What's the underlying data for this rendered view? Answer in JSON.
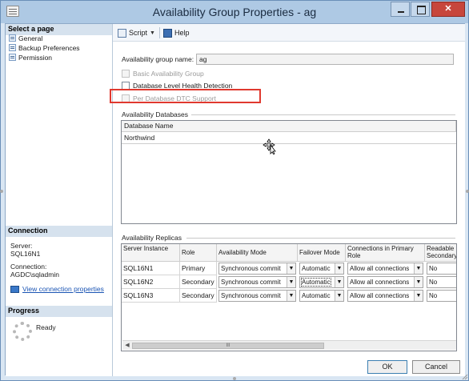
{
  "window": {
    "title": "Availability Group Properties - ag"
  },
  "sidebar": {
    "select_page_header": "Select a page",
    "pages": [
      {
        "label": "General"
      },
      {
        "label": "Backup Preferences"
      },
      {
        "label": "Permission"
      }
    ],
    "connection_header": "Connection",
    "server_label": "Server:",
    "server_value": "SQL16N1",
    "connection_label": "Connection:",
    "connection_value": "AGDC\\sqladmin",
    "view_props_link": "View connection properties",
    "progress_header": "Progress",
    "progress_status": "Ready"
  },
  "toolbar": {
    "script_label": "Script",
    "help_label": "Help"
  },
  "general": {
    "ag_name_label": "Availability group name:",
    "ag_name_value": "ag",
    "basic_ag_label": "Basic Availability Group",
    "db_health_label": "Database Level Health Detection",
    "dtc_label": "Per Database DTC Support"
  },
  "databases": {
    "section_label": "Availability Databases",
    "column_header": "Database Name",
    "rows": [
      {
        "name": "Northwind"
      }
    ]
  },
  "replicas": {
    "section_label": "Availability Replicas",
    "headers": {
      "server_instance": "Server Instance",
      "role": "Role",
      "availability_mode": "Availability Mode",
      "failover_mode": "Failover Mode",
      "connections_primary": "Connections in Primary Role",
      "readable_secondary": "Readable Secondary"
    },
    "rows": [
      {
        "server": "SQL16N1",
        "role": "Primary",
        "mode": "Synchronous commit",
        "failover": "Automatic",
        "conn_primary": "Allow all connections",
        "readable": "No"
      },
      {
        "server": "SQL16N2",
        "role": "Secondary",
        "mode": "Synchronous commit",
        "failover": "Automatic",
        "conn_primary": "Allow all connections",
        "readable": "No"
      },
      {
        "server": "SQL16N3",
        "role": "Secondary",
        "mode": "Synchronous commit",
        "failover": "Automatic",
        "conn_primary": "Allow all connections",
        "readable": "No"
      }
    ],
    "scroll_thumb_label": "III"
  },
  "buttons": {
    "ok_label": "OK",
    "cancel_label": "Cancel"
  }
}
